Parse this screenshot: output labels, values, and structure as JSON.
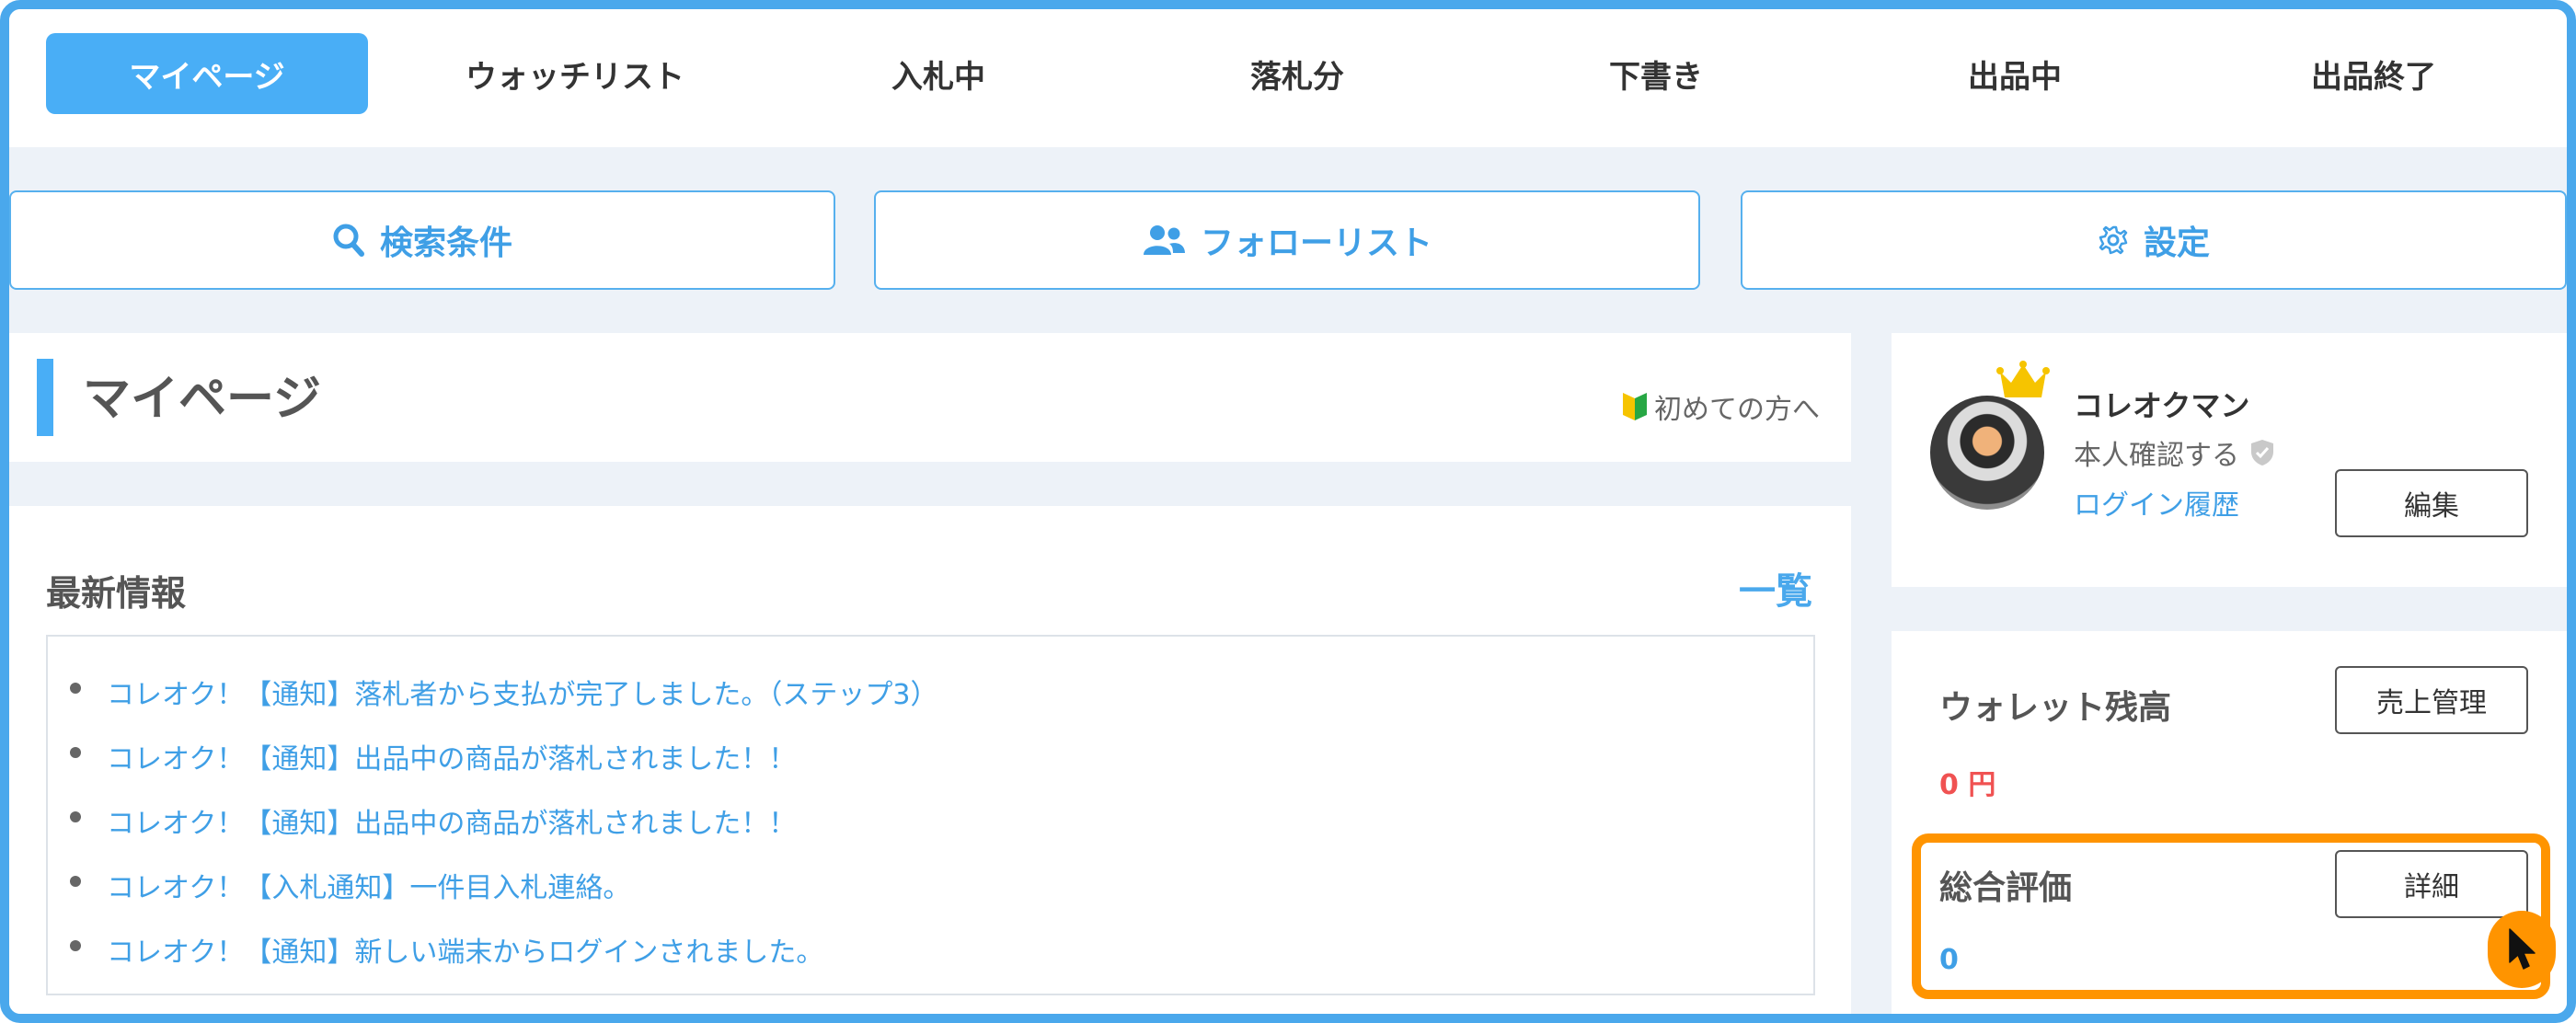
{
  "nav": {
    "tabs": [
      {
        "label": "マイページ",
        "active": true
      },
      {
        "label": "ウォッチリスト"
      },
      {
        "label": "入札中"
      },
      {
        "label": "落札分"
      },
      {
        "label": "下書き"
      },
      {
        "label": "出品中"
      },
      {
        "label": "出品終了"
      }
    ]
  },
  "quick_buttons": {
    "search": {
      "label": "検索条件",
      "icon": "search-icon"
    },
    "follow": {
      "label": "フォローリスト",
      "icon": "users-icon"
    },
    "settings": {
      "label": "設定",
      "icon": "gear-icon"
    }
  },
  "page": {
    "title": "マイページ",
    "beginner_link": "初めての方へ"
  },
  "news": {
    "title": "最新情報",
    "all_link": "一覧",
    "items": [
      "コレオク！【通知】落札者から支払が完了しました。（ステップ3）",
      "コレオク！【通知】出品中の商品が落札されました！！",
      "コレオク！【通知】出品中の商品が落札されました！！",
      "コレオク！【入札通知】一件目入札連絡。",
      "コレオク！【通知】新しい端末からログインされました。"
    ]
  },
  "profile": {
    "name": "コレオクマン",
    "verify_label": "本人確認する",
    "login_history": "ログイン履歴",
    "edit_button": "編集"
  },
  "wallet": {
    "label": "ウォレット残高",
    "value": "0 円",
    "button": "売上管理"
  },
  "rating": {
    "label": "総合評価",
    "value": "0",
    "button": "詳細"
  },
  "colors": {
    "accent": "#49aef6",
    "link": "#3f9fe6",
    "highlight": "#ff9400",
    "price": "#f05252"
  }
}
